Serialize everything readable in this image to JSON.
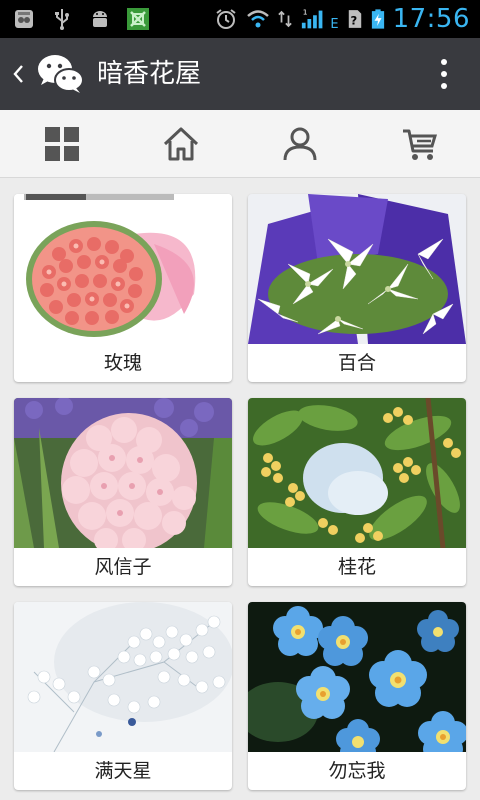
{
  "status_bar": {
    "time": "17:56",
    "network_type": "E",
    "icons": [
      "spy-app-icon",
      "usb-icon",
      "android-debug-icon",
      "screenshot-app-icon",
      "alarm-icon",
      "wifi-icon",
      "data-arrows-icon",
      "signal-icon",
      "sim-unknown-icon",
      "battery-charging-icon"
    ]
  },
  "header": {
    "title": "暗香花屋",
    "back_icon": "chevron-left-icon",
    "logo_icon": "wechat-logo-icon",
    "menu_icon": "more-vertical-icon"
  },
  "tabs": [
    {
      "icon": "grid-icon"
    },
    {
      "icon": "home-icon"
    },
    {
      "icon": "user-icon"
    },
    {
      "icon": "cart-icon"
    }
  ],
  "products": [
    {
      "name": "玫瑰"
    },
    {
      "name": "百合"
    },
    {
      "name": "风信子"
    },
    {
      "name": "桂花"
    },
    {
      "name": "满天星"
    },
    {
      "name": "勿忘我"
    }
  ],
  "colors": {
    "status_bar_bg": "#000000",
    "status_accent": "#3ab6f2",
    "header_bg": "#393a3f",
    "tabbar_bg": "#f4f4f4",
    "page_bg": "#ececec",
    "icon_gray": "#555555"
  }
}
